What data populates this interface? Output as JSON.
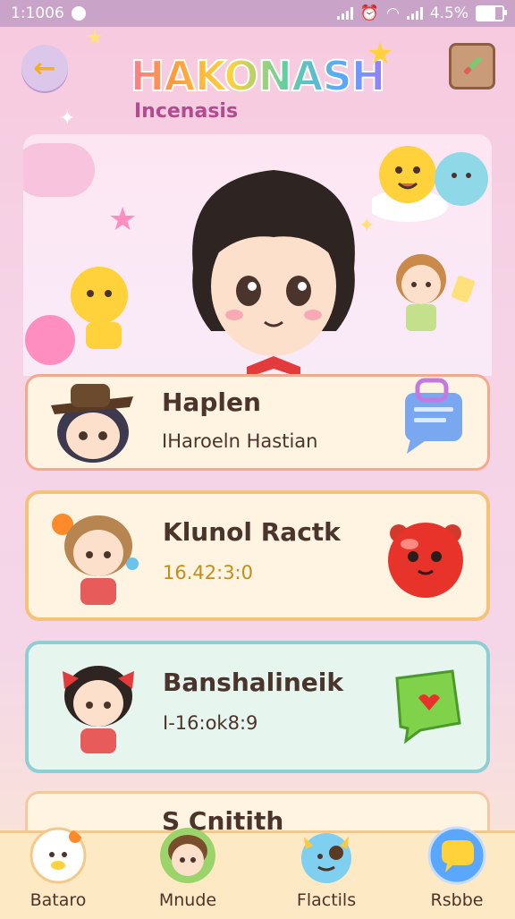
{
  "status": {
    "time": "1:1006",
    "battery": "4.5%"
  },
  "header": {
    "logo": "HAKONASH",
    "subtitle": "Incenasis"
  },
  "cards": [
    {
      "title": "Haplen",
      "subtitle": "IHaroeln Hastian"
    },
    {
      "title": "Klunol Ractk",
      "subtitle": "16.42:3:0"
    },
    {
      "title": "Banshalineik",
      "subtitle": "I-16:ok8:9"
    },
    {
      "title": "S Cnitith"
    }
  ],
  "nav": [
    {
      "label": "Bataro"
    },
    {
      "label": "Mnude"
    },
    {
      "label": "Flactils"
    },
    {
      "label": "Rsbbe"
    }
  ],
  "colors": {
    "accent": "#f3b01a",
    "card_border_2": "#f5c278",
    "card_border_3": "#8dcfd3"
  }
}
